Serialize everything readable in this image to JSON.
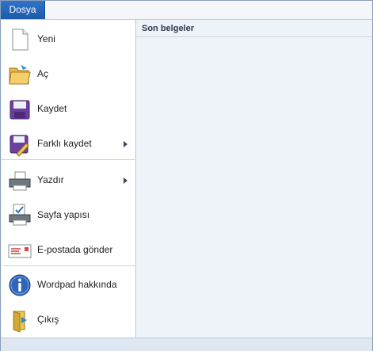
{
  "tab": {
    "label": "Dosya"
  },
  "menu": {
    "items": [
      {
        "label": "Yeni",
        "icon": "new-document-icon",
        "has_submenu": false
      },
      {
        "label": "Aç",
        "icon": "open-folder-icon",
        "has_submenu": false
      },
      {
        "label": "Kaydet",
        "icon": "save-floppy-icon",
        "has_submenu": false
      },
      {
        "label": "Farklı kaydet",
        "icon": "save-as-icon",
        "has_submenu": true
      },
      {
        "label": "Yazdır",
        "icon": "printer-icon",
        "has_submenu": true
      },
      {
        "label": "Sayfa yapısı",
        "icon": "page-setup-icon",
        "has_submenu": false
      },
      {
        "label": "E-postada gönder",
        "icon": "email-envelope-icon",
        "has_submenu": false
      },
      {
        "label": "Wordpad hakkında",
        "icon": "info-icon",
        "has_submenu": false
      },
      {
        "label": "Çıkış",
        "icon": "exit-icon",
        "has_submenu": false
      }
    ]
  },
  "recent": {
    "title": "Son belgeler"
  }
}
